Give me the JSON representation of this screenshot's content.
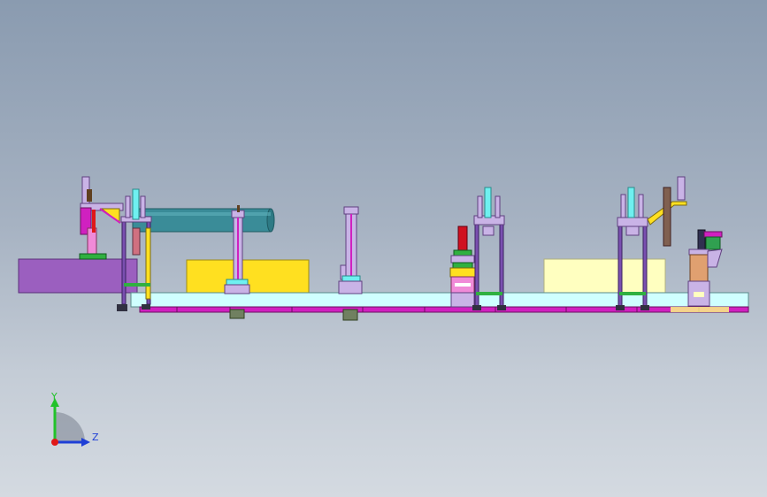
{
  "viewport": {
    "background_top": "#8a9bb0",
    "background_bottom": "#d4dae1"
  },
  "triad": {
    "y_label": "Y",
    "z_label": "Z",
    "y_color": "#22c22a",
    "z_color": "#1f3fd6",
    "x_color": "#e01818"
  },
  "colors": {
    "frame_lilac": "#c9b3e6",
    "frame_purple": "#7a4fb0",
    "magenta": "#d020c0",
    "pink": "#f08ad8",
    "cyan": "#6ff0f0",
    "light_cyan": "#cfffff",
    "yellow": "#ffe020",
    "pale_yellow": "#ffffc0",
    "violet_block": "#9b5fbf",
    "teal_cylinder": "#3a8c98",
    "orange_block": "#e0a070",
    "red": "#d01020",
    "green": "#30b040",
    "dark": "#303040"
  }
}
